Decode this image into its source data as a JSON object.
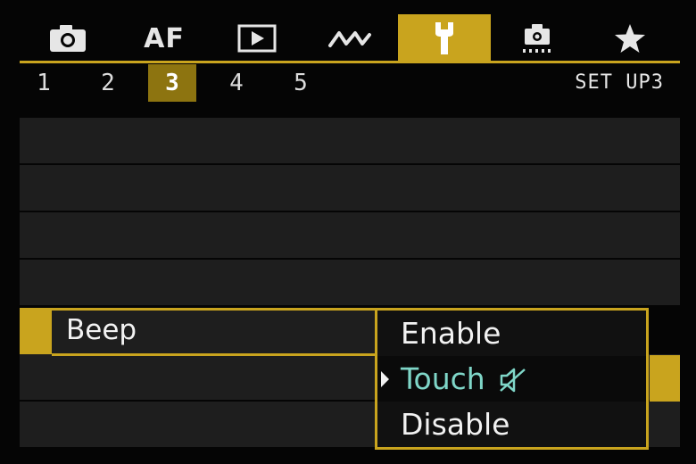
{
  "tabs": [
    {
      "icon": "camera-icon",
      "label": ""
    },
    {
      "icon": "af-text",
      "label": "AF"
    },
    {
      "icon": "playback-icon",
      "label": ""
    },
    {
      "icon": "wave-icon",
      "label": ""
    },
    {
      "icon": "wrench-icon",
      "label": "",
      "active": true
    },
    {
      "icon": "custom-functions-icon",
      "label": ""
    },
    {
      "icon": "star-icon",
      "label": ""
    }
  ],
  "pages": [
    "1",
    "2",
    "3",
    "4",
    "5"
  ],
  "active_page": "3",
  "page_title": "SET UP3",
  "setting": {
    "label": "Beep"
  },
  "options": [
    {
      "label": "Enable"
    },
    {
      "label": "Touch",
      "current": true,
      "icon": "mute-icon"
    },
    {
      "label": "Disable"
    }
  ],
  "colors": {
    "accent": "#c9a41e",
    "accent_dark": "#8d7410",
    "row_bg": "#1e1e1e",
    "current_option_text": "#7fd6c8"
  }
}
